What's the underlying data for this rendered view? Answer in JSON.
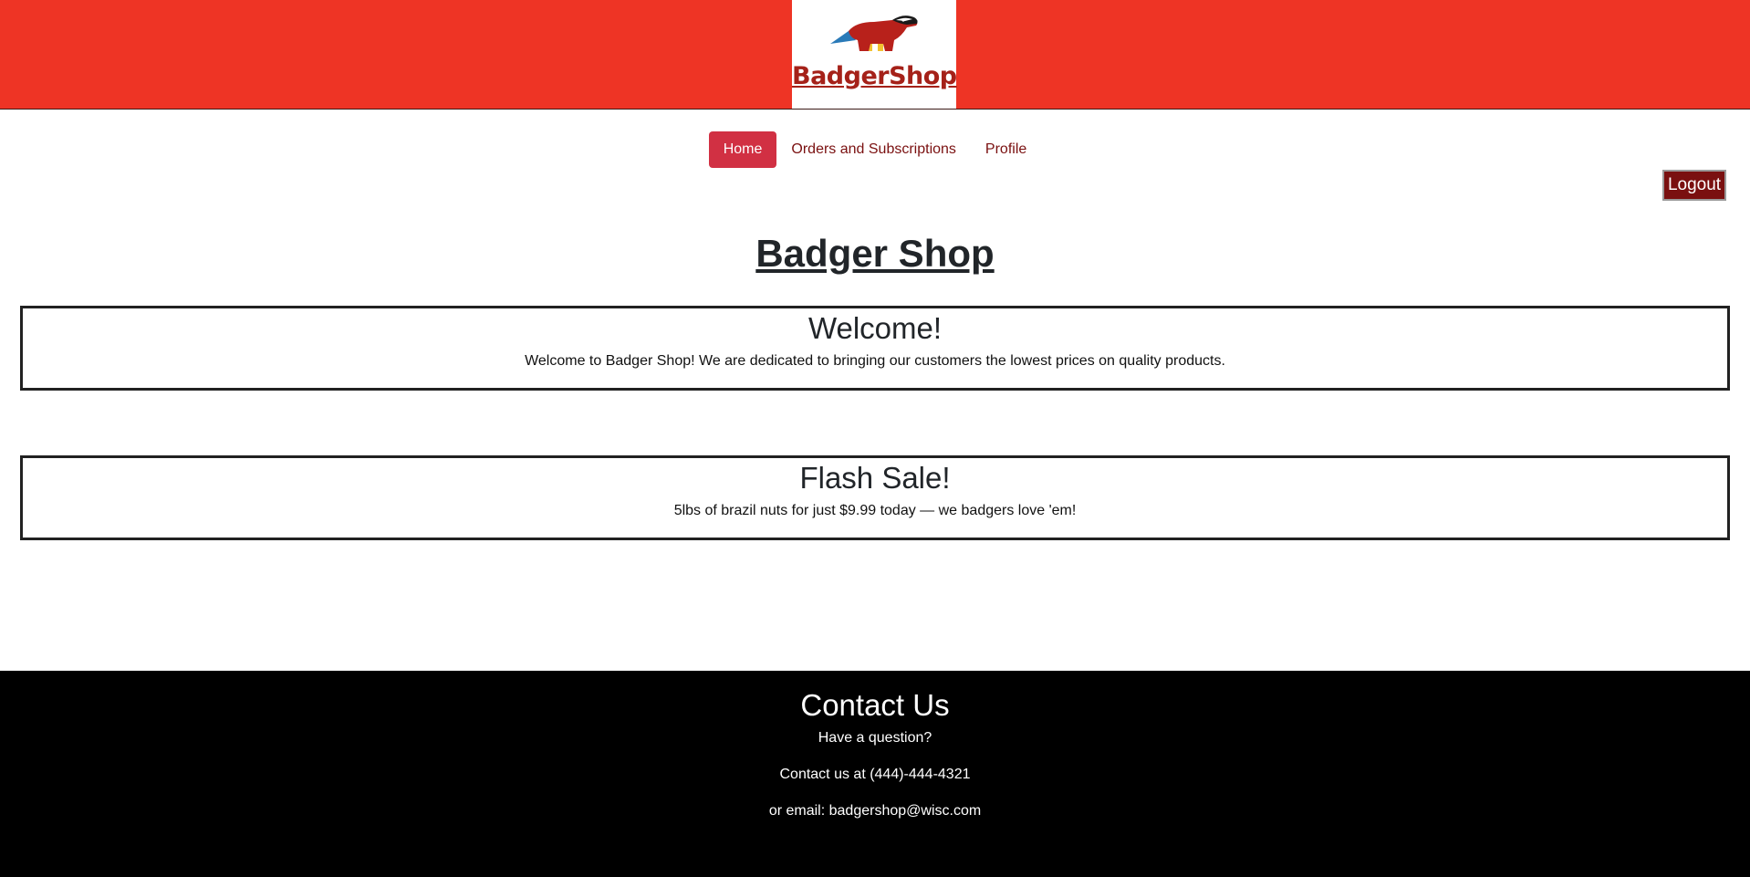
{
  "header": {
    "logo_text": "BadgerShop",
    "brand_color": "#ee3425",
    "logo_icon": "badger-icon"
  },
  "nav": {
    "items": [
      {
        "label": "Home",
        "active": true
      },
      {
        "label": "Orders and Subscriptions",
        "active": false
      },
      {
        "label": "Profile",
        "active": false
      }
    ],
    "active_color": "#d13043"
  },
  "logout": {
    "label": "Logout",
    "color": "#7a1010"
  },
  "main": {
    "title": "Badger Shop",
    "cards": [
      {
        "heading": "Welcome!",
        "text": "Welcome to Badger Shop! We are dedicated to bringing our customers the lowest prices on quality products."
      },
      {
        "heading": "Flash Sale!",
        "text": "5lbs of brazil nuts for just $9.99 today — we badgers love 'em!"
      }
    ]
  },
  "footer": {
    "heading": "Contact Us",
    "question": "Have a question?",
    "phone": "Contact us at (444)-444-4321",
    "email": "or email: badgershop@wisc.com"
  }
}
